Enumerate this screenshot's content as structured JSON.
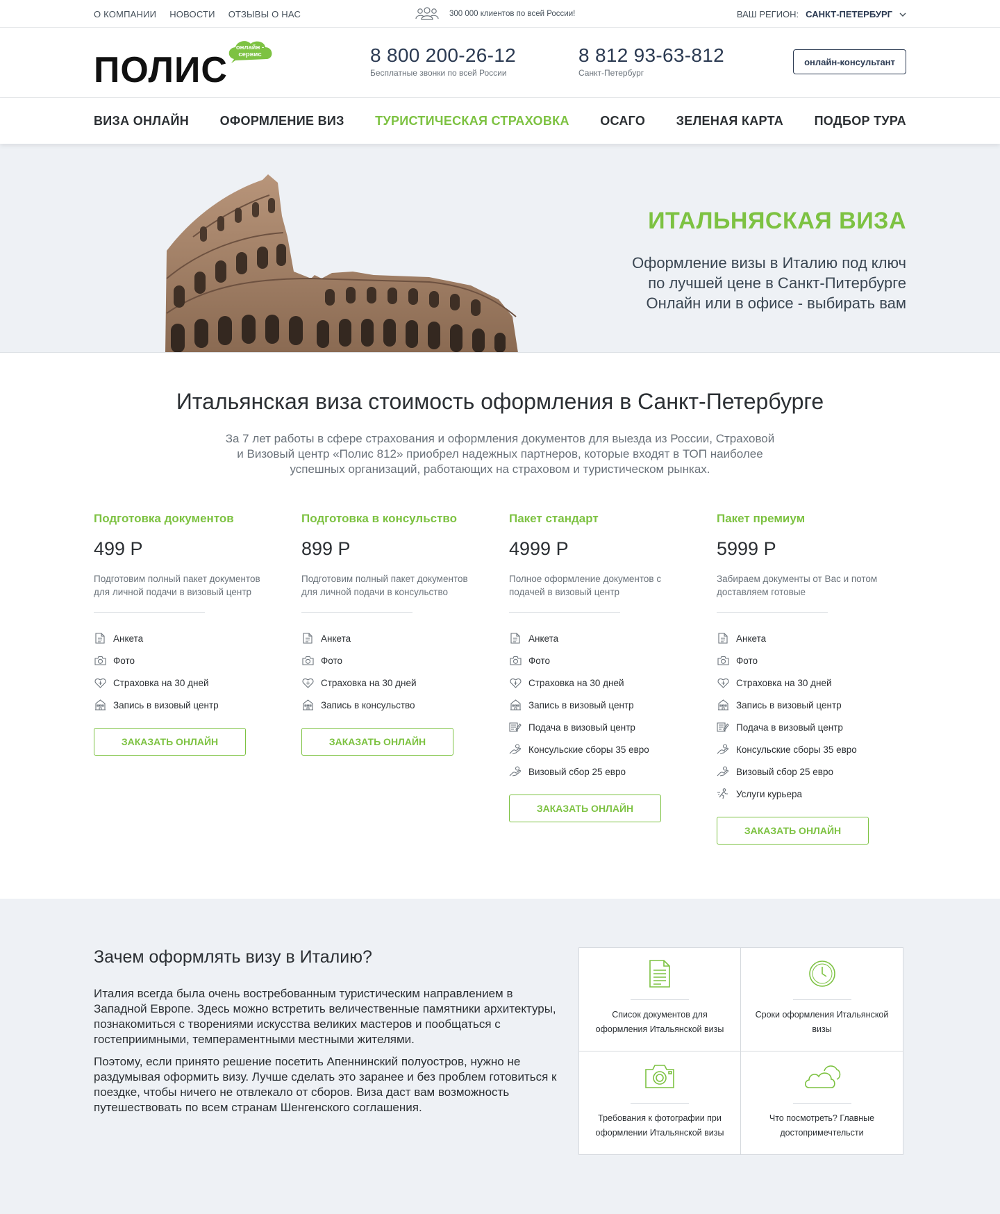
{
  "topbar": {
    "links": [
      "О компании",
      "Новости",
      "Отзывы о нас"
    ],
    "clients_text": "300 000 клиентов по всей России!",
    "region_label": "Ваш регион:",
    "region_value": "Санкт-Петербург"
  },
  "header": {
    "logo_text": "ПОЛИС",
    "logo_badge": "онлайн - сервис",
    "phones": [
      {
        "number": "8 800 200-26-12",
        "caption": "Бесплатные звонки по всей России"
      },
      {
        "number": "8 812 93-63-812",
        "caption": "Санкт-Петербург"
      }
    ],
    "consult_label": "онлайн-консультант"
  },
  "nav": {
    "items": [
      "Виза онлайн",
      "Оформление виз",
      "Туристическая страховка",
      "ОСАГО",
      "Зеленая карта",
      "Подбор тура"
    ],
    "active_index": 2
  },
  "hero": {
    "title": "ИТАЛЬНЯСКАЯ ВИЗА",
    "lines": [
      "Оформление визы в Италию под ключ",
      "по лучшей цене в Санкт-Питербурге",
      "Онлайн или в офисе - выбирать вам"
    ]
  },
  "pricing": {
    "title": "Итальянская виза стоимость оформления в Санкт-Петербурге",
    "lead": "За 7 лет работы в сфере страхования и оформления документов для выезда из России, Страховой и Визовый центр «Полис 812» приобрел надежных партнеров, которые входят в ТОП наиболее успешных организаций, работающих на страховом и туристическом рынках.",
    "button_label": "Заказать онлайн",
    "plans": [
      {
        "name": "Подготовка документов",
        "price": "499 Р",
        "desc": "Подготовим полный пакет документов для личной подачи в визовый центр",
        "features": [
          {
            "icon": "document-icon",
            "label": "Анкета"
          },
          {
            "icon": "camera-icon",
            "label": "Фото"
          },
          {
            "icon": "insurance-heart-icon",
            "label": "Страховка на 30 дней"
          },
          {
            "icon": "building-icon",
            "label": "Запись в визовый центр"
          }
        ]
      },
      {
        "name": "Подготовка в консульство",
        "price": "899 Р",
        "desc": "Подготовим полный пакет документов для личной подачи в консульство",
        "features": [
          {
            "icon": "document-icon",
            "label": "Анкета"
          },
          {
            "icon": "camera-icon",
            "label": "Фото"
          },
          {
            "icon": "insurance-heart-icon",
            "label": "Страховка на 30 дней"
          },
          {
            "icon": "building-icon",
            "label": "Запись в консульство"
          }
        ]
      },
      {
        "name": "Пакет стандарт",
        "price": "4999 Р",
        "desc": "Полное оформление документов с подачей в визовый центр",
        "features": [
          {
            "icon": "document-icon",
            "label": "Анкета"
          },
          {
            "icon": "camera-icon",
            "label": "Фото"
          },
          {
            "icon": "insurance-heart-icon",
            "label": "Страховка на 30 дней"
          },
          {
            "icon": "building-icon",
            "label": "Запись в визовый центр"
          },
          {
            "icon": "submit-form-icon",
            "label": "Подача в визовый центр"
          },
          {
            "icon": "payment-hand-icon",
            "label": "Консульские сборы 35 евро"
          },
          {
            "icon": "payment-hand-icon",
            "label": "Визовый сбор 25 евро"
          }
        ]
      },
      {
        "name": "Пакет премиум",
        "price": "5999 Р",
        "desc": "Забираем документы от Вас и потом доставляем готовые",
        "features": [
          {
            "icon": "document-icon",
            "label": "Анкета"
          },
          {
            "icon": "camera-icon",
            "label": "Фото"
          },
          {
            "icon": "insurance-heart-icon",
            "label": "Страховка на 30 дней"
          },
          {
            "icon": "building-icon",
            "label": "Запись в визовый центр"
          },
          {
            "icon": "submit-form-icon",
            "label": "Подача в визовый центр"
          },
          {
            "icon": "payment-hand-icon",
            "label": "Консульские сборы 35 евро"
          },
          {
            "icon": "payment-hand-icon",
            "label": "Визовый сбор 25 евро"
          },
          {
            "icon": "courier-icon",
            "label": "Услуги курьера"
          }
        ]
      }
    ]
  },
  "why": {
    "title": "Зачем оформлять визу в Италию?",
    "paragraphs": [
      "Италия всегда была очень востребованным туристическим направлением в Западной Европе. Здесь можно встретить величественные памятники архитектуры, познакомиться с творениями искусства великих мастеров и пообщаться с гостеприимными, темпераментными местными жителями.",
      "Поэтому, если принято решение посетить Апеннинский полуостров, нужно не раздумывая оформить визу. Лучше сделать это заранее и без проблем готовиться к поездке, чтобы ничего не отвлекало от сборов. Виза даст вам возможность путешествовать по всем странам Шенгенского соглашения."
    ],
    "tiles": [
      {
        "icon": "document-list-icon",
        "label": "Список документов для оформления Итальянской визы"
      },
      {
        "icon": "clock-icon",
        "label": "Сроки оформления Итальянской визы"
      },
      {
        "icon": "camera-icon",
        "label": "Требования к фотографии при оформлении Итальянской визы"
      },
      {
        "icon": "cloud-sun-icon",
        "label": "Что посмотреть? Главные достопримечтельсти"
      }
    ]
  },
  "colors": {
    "accent": "#7dc242",
    "dark": "#2b3a52",
    "muted": "#6b737b",
    "bg_light": "#eef1f5"
  }
}
